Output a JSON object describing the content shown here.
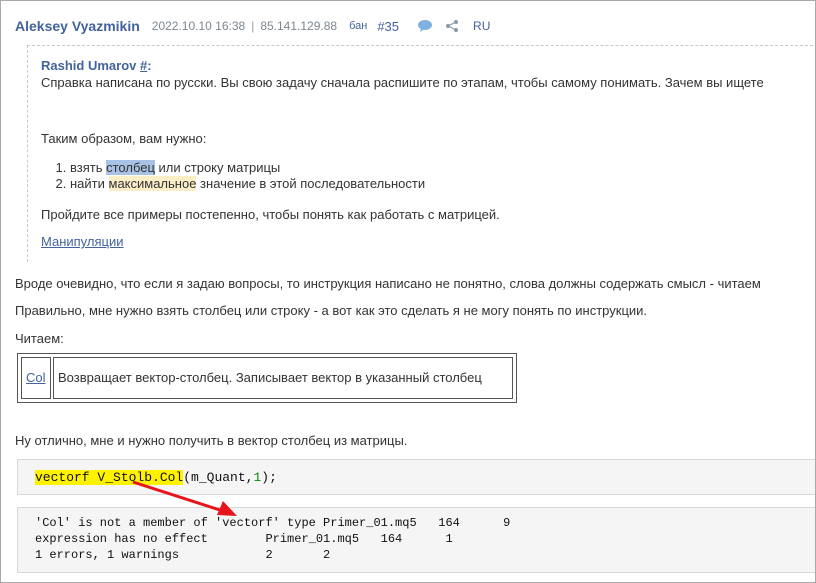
{
  "post": {
    "author": "Aleksey Vyazmikin",
    "datetime": "2022.10.10 16:38",
    "separator": "|",
    "ip": "85.141.129.88",
    "ban": "бан",
    "number": "#35",
    "lang": "RU"
  },
  "quote": {
    "author": "Rashid Umarov",
    "hash": "#",
    "colon": ":",
    "line1": "Справка написана по русски. Вы свою задачу сначала распишите по этапам, чтобы самому понимать. Зачем вы ищете",
    "line2": "Таким образом, вам нужно:",
    "list": [
      {
        "pre": "взять ",
        "hl": "столбец",
        "post": " или строку матрицы"
      },
      {
        "pre": "найти ",
        "hl": "максимальное",
        "post": " значение в этой последовательности"
      }
    ],
    "line3": "Пройдите все примеры постепенно, чтобы понять как работать с матрицей.",
    "link": "Манипуляции"
  },
  "body": {
    "p1": "Вроде очевидно, что если я задаю вопросы, то инструкция написано не понятно, слова должны содержать смысл - читаем",
    "p2": "Правильно, мне нужно взять столбец или строку - а вот как это сделать я не могу понять по инструкции.",
    "p3": "Читаем:",
    "table": {
      "link": "Col",
      "desc": "Возвращает вектор-столбец. Записывает вектор в указанный столбец"
    },
    "p4": "Ну отлично, мне и нужно получить в вектор столбец из матрицы."
  },
  "code": {
    "hl": "vectorf V_Stolb.Col",
    "rest1": "(m_Quant,",
    "num": "1",
    "rest2": ");"
  },
  "errors": [
    "'Col' is not a member of 'vectorf' type Primer_01.mq5   164      9",
    "expression has no effect        Primer_01.mq5   164      1",
    "1 errors, 1 warnings            2       2"
  ],
  "colors": {
    "link": "#42639c",
    "highlight_yellow": "#fff200",
    "highlight_blue": "#a7c2e4",
    "arrow": "#e8141b"
  }
}
